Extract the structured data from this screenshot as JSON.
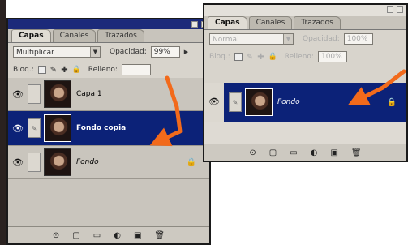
{
  "left_panel": {
    "tabs": [
      "Capas",
      "Canales",
      "Trazados"
    ],
    "blend_mode": "Multiplicar",
    "opacity_label": "Opacidad:",
    "opacity_value": "99%",
    "lock_label": "Bloq.:",
    "fill_label": "Relleno:",
    "layers": [
      {
        "name": "Capa 1"
      },
      {
        "name": "Fondo copia"
      },
      {
        "name": "Fondo"
      }
    ]
  },
  "right_panel": {
    "tabs": [
      "Capas",
      "Canales",
      "Trazados"
    ],
    "blend_mode": "Normal",
    "opacity_label": "Opacidad:",
    "opacity_value": "100%",
    "lock_label": "Bloq.:",
    "fill_label": "Relleno:",
    "fill_value": "100%",
    "layers": [
      {
        "name": "Fondo"
      }
    ]
  },
  "icons": {
    "eye": "eye-icon",
    "lock": "lock-icon",
    "arrow": "orange-annotation-arrow"
  },
  "colors": {
    "selected_layer": "#0c2278",
    "titlebar": "#1c2a7a",
    "annotation_arrow": "#f26a1b"
  }
}
